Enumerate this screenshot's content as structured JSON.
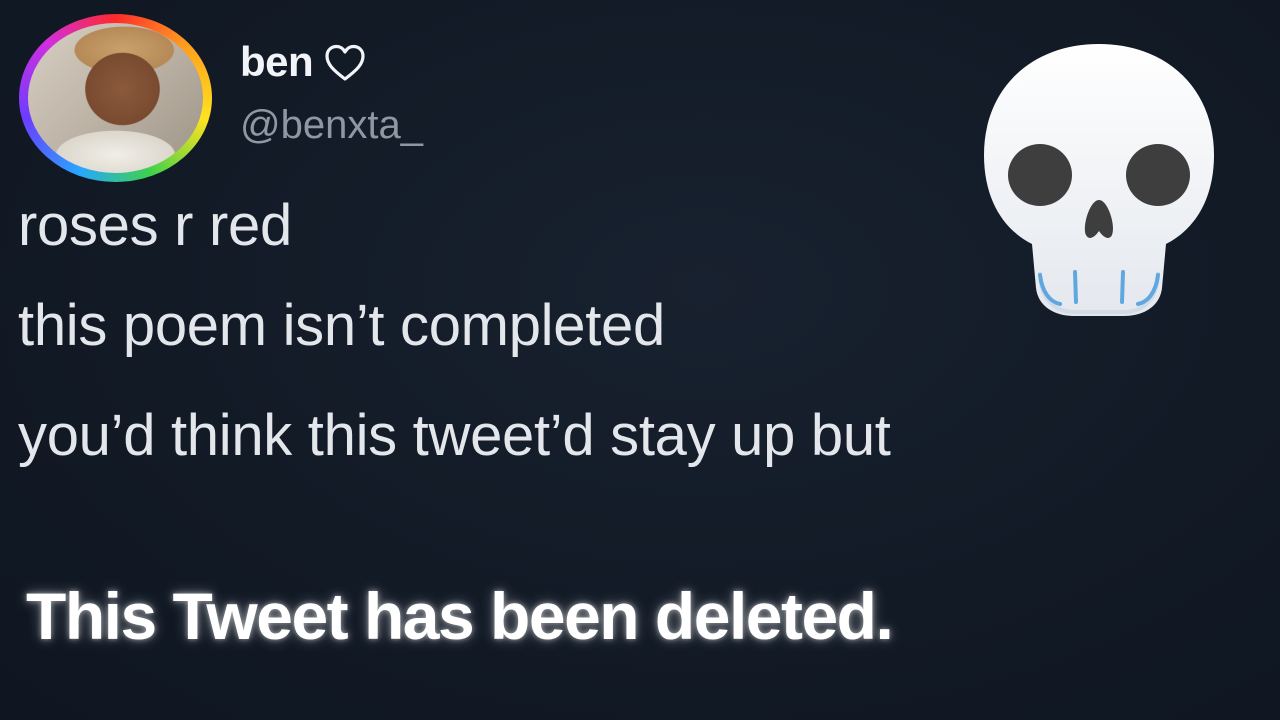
{
  "tweet": {
    "display_name": "ben",
    "handle": "@benxta_",
    "lines": [
      "roses r red",
      "this poem isn’t completed",
      "you’d think this tweet’d stay up but"
    ]
  },
  "overlay": {
    "deleted_message": "This Tweet has been deleted."
  },
  "icons": {
    "heart": "heart-outline-icon",
    "skull": "skull-emoji-icon",
    "avatar_ring_colors": [
      "#ff2a2a",
      "#ff9a1f",
      "#ffe21f",
      "#3fd24a",
      "#27a7ff",
      "#6b3dff",
      "#d12ee0"
    ]
  },
  "colors": {
    "background": "#141c28",
    "primary_text": "#e3e6ea",
    "secondary_text": "#8e97a3"
  }
}
